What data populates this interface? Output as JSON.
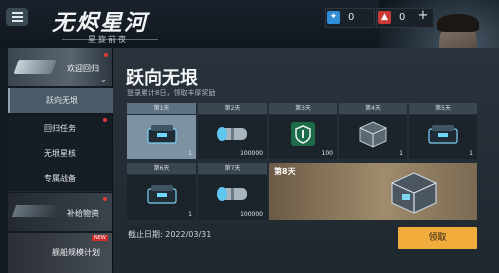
{
  "header": {
    "logo_title": "无烬星河",
    "logo_subtitle": "星旋前夜",
    "currency_blue": "0",
    "currency_red": "0",
    "plus_symbol": "+"
  },
  "sidebar": {
    "banner_welcome": "欢迎回归",
    "items": [
      {
        "label": "跃向无垠",
        "active": true
      },
      {
        "label": "回归任务"
      },
      {
        "label": "无垠星核"
      },
      {
        "label": "专属战备"
      }
    ],
    "banner_supply": "补给物资",
    "banner_plan": "舰船规模计划",
    "new_badge": "NEW"
  },
  "main": {
    "title": "跃向无垠",
    "subtitle": "登录累计8日，领取丰厚奖励",
    "days": [
      {
        "label": "第1天",
        "count": "1",
        "icon": "chest-icon",
        "claimed": true
      },
      {
        "label": "第2天",
        "count": "100000",
        "icon": "canister-icon"
      },
      {
        "label": "第3天",
        "count": "100",
        "icon": "shield-icon"
      },
      {
        "label": "第4天",
        "count": "1",
        "icon": "crate-icon"
      },
      {
        "label": "第5天",
        "count": "1",
        "icon": "chest-icon"
      },
      {
        "label": "第6天",
        "count": "1",
        "icon": "chest-icon"
      },
      {
        "label": "第7天",
        "count": "100000",
        "icon": "canister-icon"
      }
    ],
    "grand_prize_label": "第8天",
    "deadline": "截止日期: 2022/03/31",
    "claim_button": "领取"
  }
}
